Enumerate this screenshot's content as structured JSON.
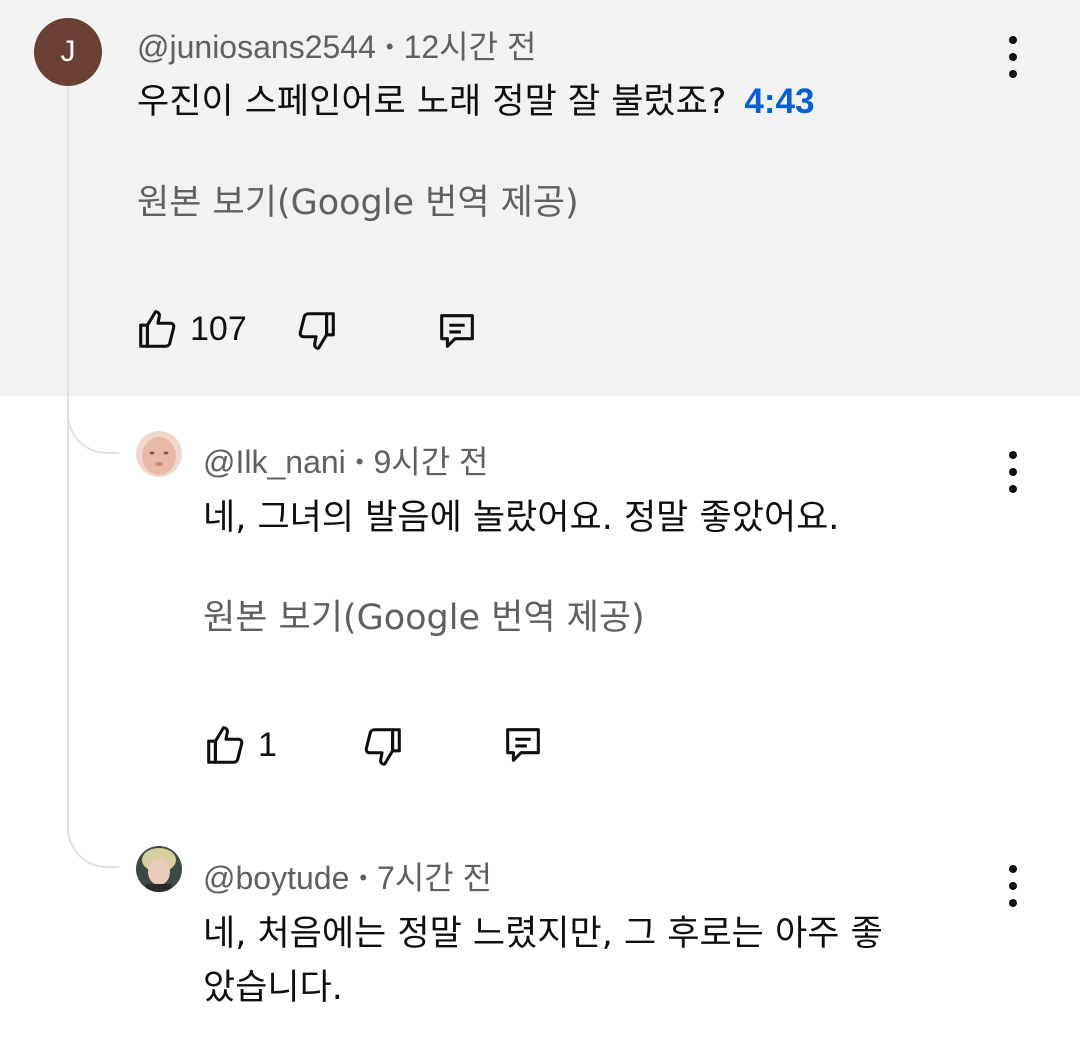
{
  "comments": [
    {
      "avatar_letter": "J",
      "avatar_color": "#6b4034",
      "username": "@juniosans2544",
      "time": "12시간 전",
      "text": "우진이 스페인어로 노래 정말 잘 불렀죠?",
      "timestamp_link": "4:43",
      "translate_label": "원본 보기(Google 번역 제공)",
      "likes": "107"
    },
    {
      "username": "@Ilk_nani",
      "time": "9시간 전",
      "text": "네, 그녀의 발음에 놀랐어요. 정말 좋았어요.",
      "translate_label": "원본 보기(Google 번역 제공)",
      "likes": "1"
    },
    {
      "username": "@boytude",
      "time": "7시간 전",
      "text_line1": "네, 처음에는 정말 느렸지만, 그 후로는 아주 좋",
      "text_line2": "았습니다."
    }
  ],
  "icons": {
    "like": "thumbs-up-icon",
    "dislike": "thumbs-down-icon",
    "reply": "reply-comment-icon",
    "more": "more-vert-icon"
  },
  "colors": {
    "highlight_bg": "#f2f2f2",
    "link_blue": "#065fd4",
    "meta_gray": "#606060"
  }
}
